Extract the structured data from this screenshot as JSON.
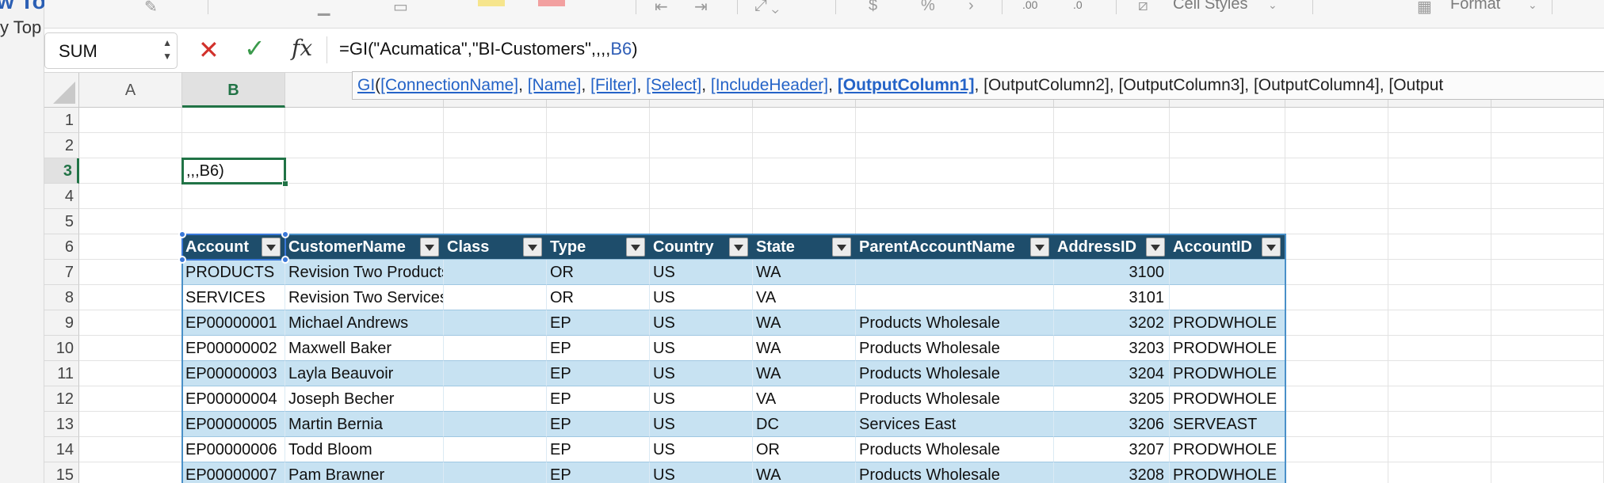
{
  "behind_window": {
    "title_fragment": "w To",
    "subtitle_fragment": "y Top"
  },
  "ribbon": {
    "cell_styles_label": "Cell Styles",
    "format_label": "Format",
    "decimal_more": ".00",
    "decimal_less": ".0"
  },
  "formula_bar": {
    "name_box": "SUM",
    "cancel_glyph": "✕",
    "enter_glyph": "✓",
    "fx_label": "fx",
    "formula_prefix": "=GI(\"Acumatica\",\"BI-Customers\",,,,",
    "formula_ref": "B6",
    "formula_suffix": ")"
  },
  "tooltip": {
    "fn": "GI",
    "open": "(",
    "args_linked": [
      "[ConnectionName]",
      "[Name]",
      "[Filter]",
      "[Select]",
      "[IncludeHeader]"
    ],
    "arg_current": "[OutputColumn1]",
    "args_rest": "[OutputColumn2], [OutputColumn3], [OutputColumn4], [Output"
  },
  "columns": [
    "A",
    "B",
    "",
    "",
    "",
    "",
    "",
    "",
    "",
    "",
    "",
    "",
    ""
  ],
  "rows": [
    "1",
    "2",
    "3",
    "4",
    "5",
    "6",
    "7",
    "8",
    "9",
    "10",
    "11",
    "12",
    "13",
    "14",
    "15"
  ],
  "active_cell": {
    "row": "3",
    "col": "B",
    "text": ",,,B6)"
  },
  "table": {
    "headers": [
      "Account",
      "CustomerName",
      "Class",
      "Type",
      "Country",
      "State",
      "ParentAccountName",
      "AddressID",
      "AccountID"
    ],
    "rows": [
      [
        "PRODUCTS",
        "Revision Two Products",
        "",
        "OR",
        "US",
        "WA",
        "",
        "3100",
        ""
      ],
      [
        "SERVICES",
        "Revision Two Services",
        "",
        "OR",
        "US",
        "VA",
        "",
        "3101",
        ""
      ],
      [
        "EP00000001",
        "Michael Andrews",
        "",
        "EP",
        "US",
        "WA",
        "Products Wholesale",
        "3202",
        "PRODWHOLE"
      ],
      [
        "EP00000002",
        "Maxwell Baker",
        "",
        "EP",
        "US",
        "WA",
        "Products Wholesale",
        "3203",
        "PRODWHOLE"
      ],
      [
        "EP00000003",
        "Layla Beauvoir",
        "",
        "EP",
        "US",
        "WA",
        "Products Wholesale",
        "3204",
        "PRODWHOLE"
      ],
      [
        "EP00000004",
        "Joseph Becher",
        "",
        "EP",
        "US",
        "VA",
        "Products Wholesale",
        "3205",
        "PRODWHOLE"
      ],
      [
        "EP00000005",
        "Martin Bernia",
        "",
        "EP",
        "US",
        "DC",
        "Services East",
        "3206",
        "SERVEAST"
      ],
      [
        "EP00000006",
        "Todd Bloom",
        "",
        "EP",
        "US",
        "OR",
        "Products Wholesale",
        "3207",
        "PRODWHOLE"
      ],
      [
        "EP00000007",
        "Pam Brawner",
        "",
        "EP",
        "US",
        "WA",
        "Products Wholesale",
        "3208",
        "PRODWHOLE"
      ]
    ]
  },
  "colors": {
    "table_header": "#1e4d6b",
    "band": "#c7e2f2",
    "selection_green": "#217346",
    "accent_blue": "#3a78d8"
  }
}
